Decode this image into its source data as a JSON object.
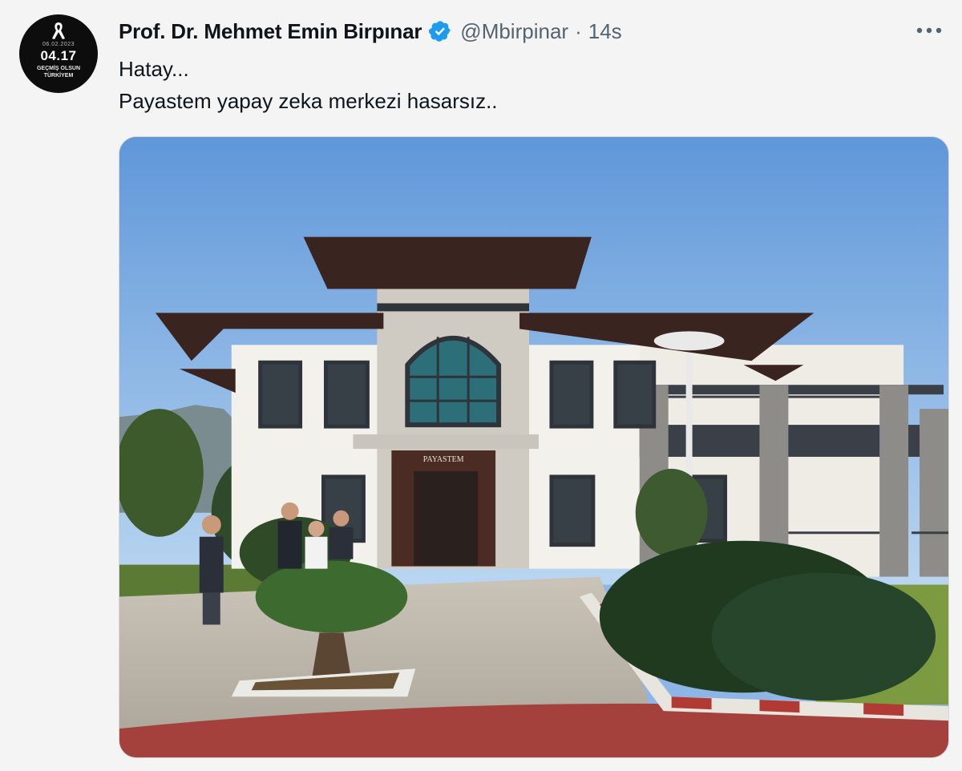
{
  "author": {
    "avatar_date": "06.02.2023",
    "avatar_time": "04.17",
    "avatar_line1": "GEÇMİŞ OLSUN",
    "avatar_line2": "TÜRKİYEM",
    "display_name": "Prof. Dr. Mehmet Emin Birpınar",
    "handle": "@Mbirpinar",
    "separator": "·",
    "time": "14s"
  },
  "tweet": {
    "line1": "Hatay...",
    "line2": "Payastem yapay zeka merkezi hasarsız.."
  },
  "media": {
    "building_sign": "PAYASTEM"
  },
  "icons": {
    "verified": "verified-badge-icon",
    "more": "more-dots-icon",
    "ribbon": "mourning-ribbon-icon"
  },
  "colors": {
    "verified": "#1d9bf0",
    "secondary_text": "#536471",
    "sky": "#8db6e6"
  }
}
